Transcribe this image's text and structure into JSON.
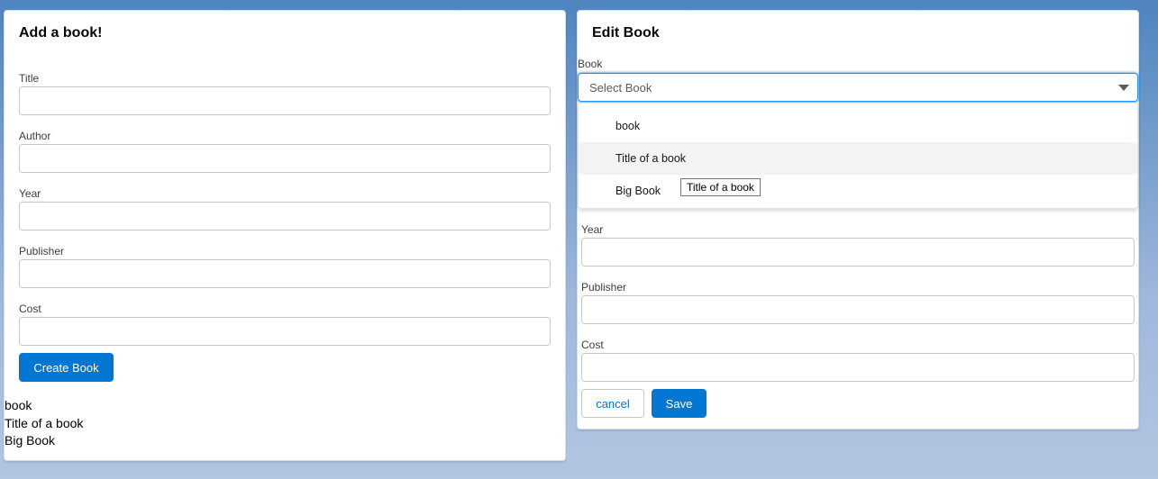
{
  "add_form": {
    "title": "Add a book!",
    "fields": {
      "title": {
        "label": "Title",
        "value": ""
      },
      "author": {
        "label": "Author",
        "value": ""
      },
      "year": {
        "label": "Year",
        "value": ""
      },
      "publisher": {
        "label": "Publisher",
        "value": ""
      },
      "cost": {
        "label": "Cost",
        "value": ""
      }
    },
    "submit_label": "Create Book",
    "book_list": [
      "book",
      "Title of a book",
      "Big Book"
    ]
  },
  "edit_form": {
    "title": "Edit Book",
    "book_select": {
      "label": "Book",
      "placeholder": "Select Book",
      "options": [
        "book",
        "Title of a book",
        "Big Book"
      ],
      "hovered_option": "Title of a book"
    },
    "tooltip": "Title of a book",
    "fields": {
      "year": {
        "label": "Year",
        "value": ""
      },
      "publisher": {
        "label": "Publisher",
        "value": ""
      },
      "cost": {
        "label": "Cost",
        "value": ""
      }
    },
    "cancel_label": "cancel",
    "save_label": "Save"
  },
  "colors": {
    "brand": "#0176d3",
    "focus": "#1b96ff",
    "background": "#6b97c8"
  }
}
